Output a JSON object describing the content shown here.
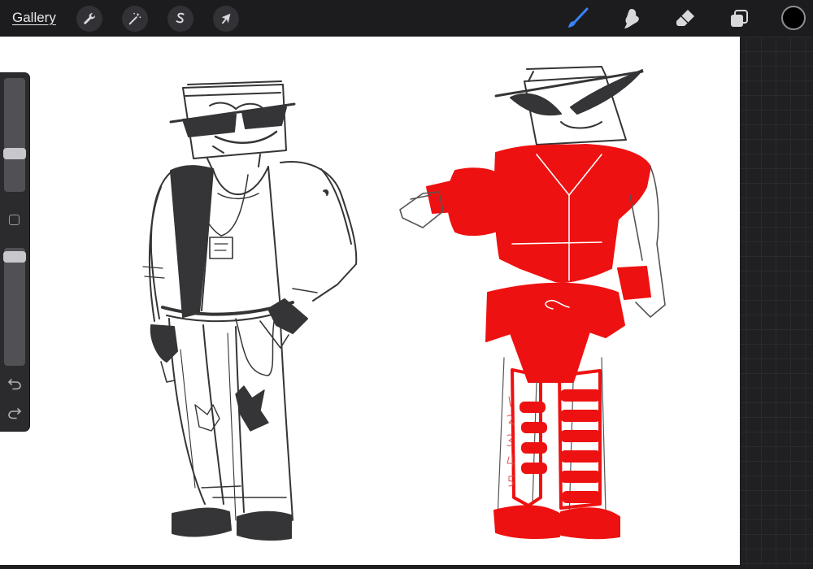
{
  "toolbar": {
    "gallery_label": "Gallery",
    "left_tools": [
      {
        "name": "actions",
        "icon": "wrench-icon"
      },
      {
        "name": "adjustments",
        "icon": "magic-wand-icon"
      },
      {
        "name": "selection",
        "icon": "selection-s-icon"
      },
      {
        "name": "transform",
        "icon": "arrow-cursor-icon"
      }
    ],
    "right_tools": [
      {
        "name": "brush",
        "icon": "brush-icon",
        "active": true
      },
      {
        "name": "smudge",
        "icon": "smudge-finger-icon",
        "active": false
      },
      {
        "name": "eraser",
        "icon": "eraser-icon",
        "active": false
      },
      {
        "name": "layers",
        "icon": "layers-icon",
        "active": false
      }
    ],
    "current_color": "#000000"
  },
  "sidebar": {
    "brush_size_level": 0.32,
    "opacity_level": 0.97,
    "icons": [
      "modify-square-icon",
      "undo-icon",
      "redo-icon"
    ]
  },
  "colors": {
    "accent": "#3a82f7",
    "ink": "#2e2e30",
    "red_paint": "#ee1111",
    "canvas": "#ffffff"
  }
}
